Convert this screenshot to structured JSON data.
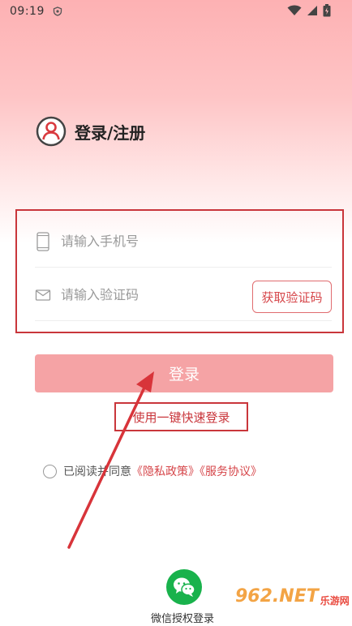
{
  "status_bar": {
    "time": "09:19"
  },
  "header": {
    "title": "登录/注册"
  },
  "form": {
    "phone_placeholder": "请输入手机号",
    "code_placeholder": "请输入验证码",
    "get_code_label": "获取验证码"
  },
  "login_button": {
    "label": "登录"
  },
  "quick_login": {
    "label": "使用一键快速登录"
  },
  "agreement": {
    "prefix": "已阅读并同意",
    "privacy_link": "《隐私政策》",
    "service_link": "《服务协议》"
  },
  "wechat": {
    "label": "微信授权登录"
  },
  "watermark": {
    "text": "962.NET",
    "subtext": "乐游网"
  },
  "colors": {
    "accent": "#c9363b",
    "button": "#f5a3a5",
    "wechat": "#19b24c"
  }
}
